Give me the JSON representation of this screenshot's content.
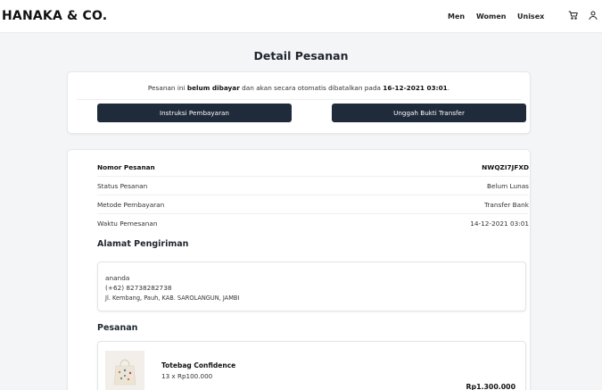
{
  "header": {
    "brand": "HANAKA & CO.",
    "nav": [
      "Men",
      "Women",
      "Unisex"
    ],
    "icons": [
      "cart-icon",
      "user-icon"
    ]
  },
  "page": {
    "title": "Detail Pesanan"
  },
  "notice": {
    "prefix": "Pesanan ini ",
    "status_bold": "belum dibayar",
    "middle": " dan akan secara otomatis dibatalkan pada ",
    "deadline": "16-12-2021 03:01",
    "suffix": ".",
    "btn_instruksi": "Instruksi Pembayaran",
    "btn_unggah": "Unggah Bukti Transfer"
  },
  "order": {
    "rows": [
      {
        "label": "Nomor Pesanan",
        "value": "NWQZI7JFXD"
      },
      {
        "label": "Status Pesanan",
        "value": "Belum Lunas"
      },
      {
        "label": "Metode Pembayaran",
        "value": "Transfer Bank"
      },
      {
        "label": "Waktu Pemesanan",
        "value": "14-12-2021 03:01"
      }
    ],
    "address_title": "Alamat Pengiriman",
    "address": {
      "name": "ananda",
      "phone": "(+62) 82738282738",
      "street": "Jl. Kembang, Pauh, KAB. SAROLANGUN, JAMBI"
    },
    "items_title": "Pesanan",
    "item": {
      "name": "Totebag Confidence",
      "qty": "13 x Rp100.000",
      "total": "Rp1.300.000"
    }
  },
  "colors": {
    "button": "#1f2a3a",
    "background": "#f4f5f7"
  }
}
